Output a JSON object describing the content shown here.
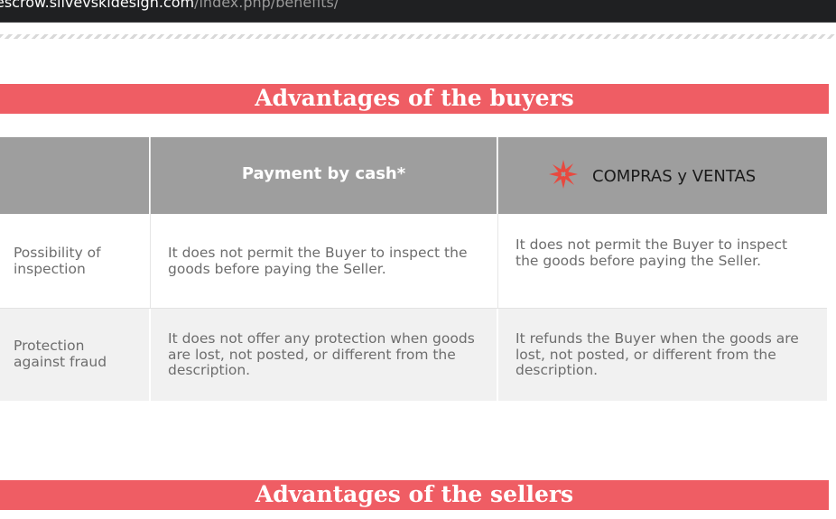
{
  "browser": {
    "url_host": "escrow.silvevskidesign.com",
    "url_path": "/index.php/benefits/"
  },
  "sections": {
    "buyers_title": "Advantages of the buyers",
    "sellers_title": "Advantages of the sellers"
  },
  "table": {
    "headers": {
      "empty": "",
      "cash": "Payment by cash*",
      "brand": "COMPRAS y VENTAS"
    },
    "rows": [
      {
        "label": "Possibility of inspection",
        "cash": "It does not permit the Buyer to inspect the goods before paying the Seller.",
        "brand": "It does not permit the Buyer to inspect the goods before paying the Seller."
      },
      {
        "label": "Protection against fraud",
        "cash": "It does not offer any protection when goods are lost, not posted, or different from the description.",
        "brand": "It refunds the Buyer when the goods are lost, not posted, or different from the description."
      }
    ]
  },
  "colors": {
    "banner": "#ef5d64",
    "header_bg": "#9e9e9e",
    "row_alt": "#f1f1f1",
    "text": "#6d6d6d",
    "logo": "#e8493f"
  },
  "icons": {
    "brand_logo": "compras-y-ventas-logo-icon"
  }
}
